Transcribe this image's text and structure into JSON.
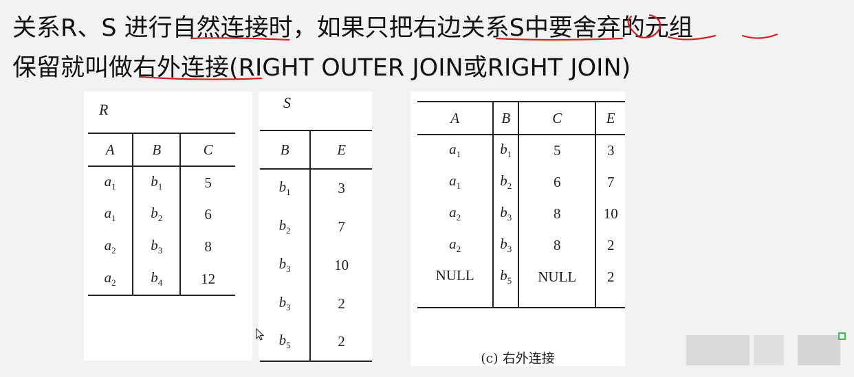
{
  "heading": {
    "line1": "关系R、S 进行自然连接时，如果只把右边关系S中要舍弃的元组",
    "line2": "保留就叫做右外连接(RIGHT OUTER JOIN或RIGHT JOIN)"
  },
  "table_r": {
    "name": "R",
    "columns": [
      "A",
      "B",
      "C"
    ],
    "rows": [
      {
        "a": "a",
        "a_sub": "1",
        "b": "b",
        "b_sub": "1",
        "c": "5"
      },
      {
        "a": "a",
        "a_sub": "1",
        "b": "b",
        "b_sub": "2",
        "c": "6"
      },
      {
        "a": "a",
        "a_sub": "2",
        "b": "b",
        "b_sub": "3",
        "c": "8"
      },
      {
        "a": "a",
        "a_sub": "2",
        "b": "b",
        "b_sub": "4",
        "c": "12"
      }
    ]
  },
  "table_s": {
    "name": "S",
    "columns": [
      "B",
      "E"
    ],
    "rows": [
      {
        "b": "b",
        "b_sub": "1",
        "e": "3"
      },
      {
        "b": "b",
        "b_sub": "2",
        "e": "7"
      },
      {
        "b": "b",
        "b_sub": "3",
        "e": "10"
      },
      {
        "b": "b",
        "b_sub": "3",
        "e": "2"
      },
      {
        "b": "b",
        "b_sub": "5",
        "e": "2"
      }
    ]
  },
  "table_result": {
    "columns": [
      "A",
      "B",
      "C",
      "E"
    ],
    "rows": [
      {
        "a": "a",
        "a_sub": "1",
        "b": "b",
        "b_sub": "1",
        "c": "5",
        "e": "3"
      },
      {
        "a": "a",
        "a_sub": "1",
        "b": "b",
        "b_sub": "2",
        "c": "6",
        "e": "7"
      },
      {
        "a": "a",
        "a_sub": "2",
        "b": "b",
        "b_sub": "3",
        "c": "8",
        "e": "10"
      },
      {
        "a": "a",
        "a_sub": "2",
        "b": "b",
        "b_sub": "3",
        "c": "8",
        "e": "2"
      },
      {
        "a": "NULL",
        "a_sub": "",
        "b": "b",
        "b_sub": "5",
        "c": "NULL",
        "e": "2"
      }
    ],
    "caption": "(c) 右外连接"
  },
  "colors": {
    "annotation": "#d42020",
    "indicator": "#3cc23c"
  }
}
